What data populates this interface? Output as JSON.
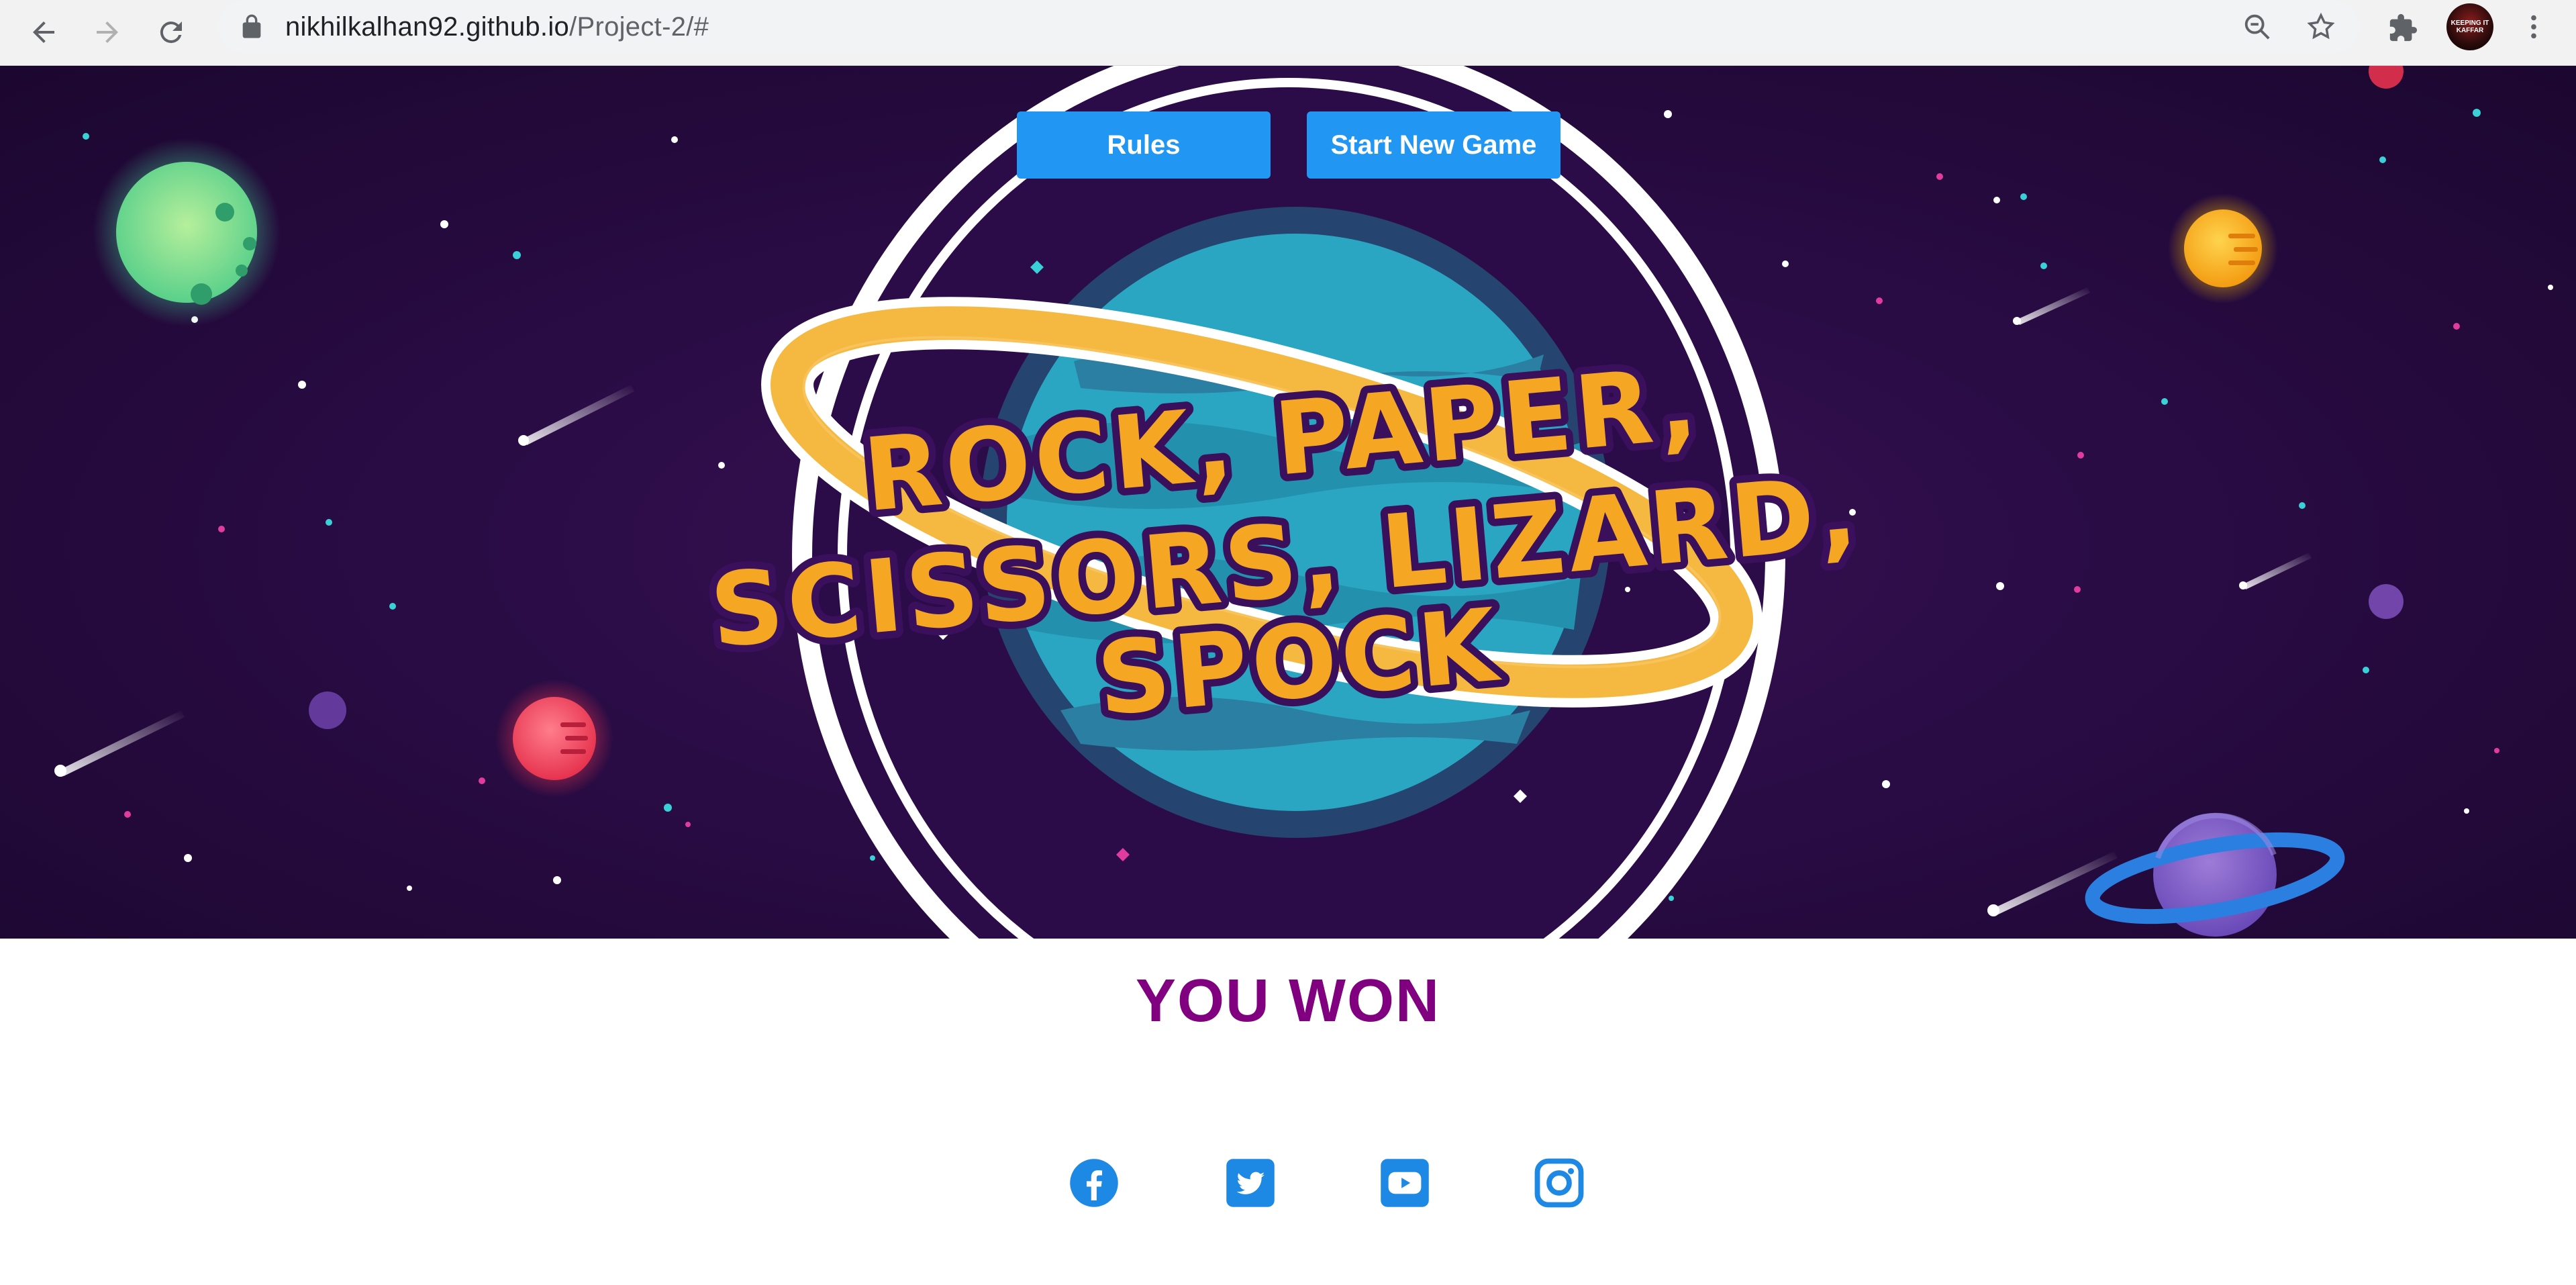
{
  "browser": {
    "url_host": "nikhilkalhan92.github.io",
    "url_path": "/Project-2/#",
    "profile_label": "KEEPING IT KAFFAR"
  },
  "hero": {
    "title_lines": [
      "ROCK, PAPER,",
      "SCISSORS, LIZARD,",
      "SPOCK"
    ],
    "rules_label": "Rules",
    "new_game_label": "Start New Game"
  },
  "result": {
    "text": "YOU WON"
  },
  "socials": [
    "facebook-icon",
    "twitter-icon",
    "youtube-icon",
    "instagram-icon"
  ],
  "colors": {
    "button": "#2196f3",
    "result": "#800080",
    "title": "#f5a623",
    "social": "#1e88e5"
  }
}
